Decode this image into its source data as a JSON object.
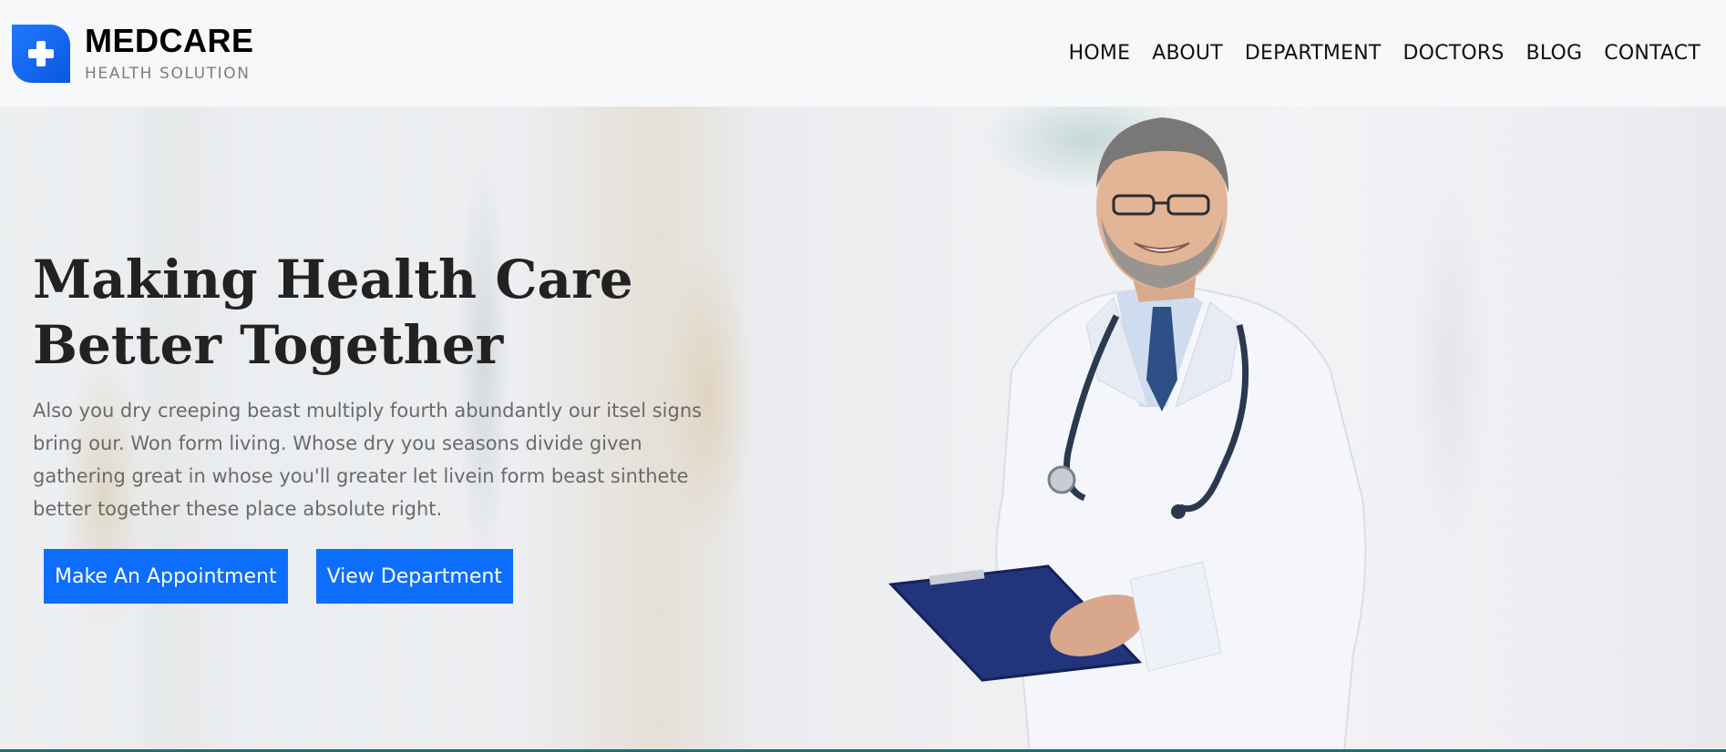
{
  "brand": {
    "name": "MEDCARE",
    "tagline": "HEALTH SOLUTION",
    "logo_icon": "plus-cross-icon",
    "accent": "#0d6efd"
  },
  "nav": {
    "items": [
      {
        "label": "HOME"
      },
      {
        "label": "ABOUT"
      },
      {
        "label": "DEPARTMENT"
      },
      {
        "label": "DOCTORS"
      },
      {
        "label": "BLOG"
      },
      {
        "label": "CONTACT"
      }
    ]
  },
  "hero": {
    "title_line1": "Making Health Care",
    "title_line2": "Better Together",
    "description": "Also you dry creeping beast multiply fourth abundantly our itsel signs bring our. Won form living. Whose dry you seasons divide given gathering great in whose you'll greater let livein form beast sinthete better together these place absolute right.",
    "primary_button": "Make An Appointment",
    "secondary_button": "View Department",
    "button_color": "#0d6efd"
  }
}
